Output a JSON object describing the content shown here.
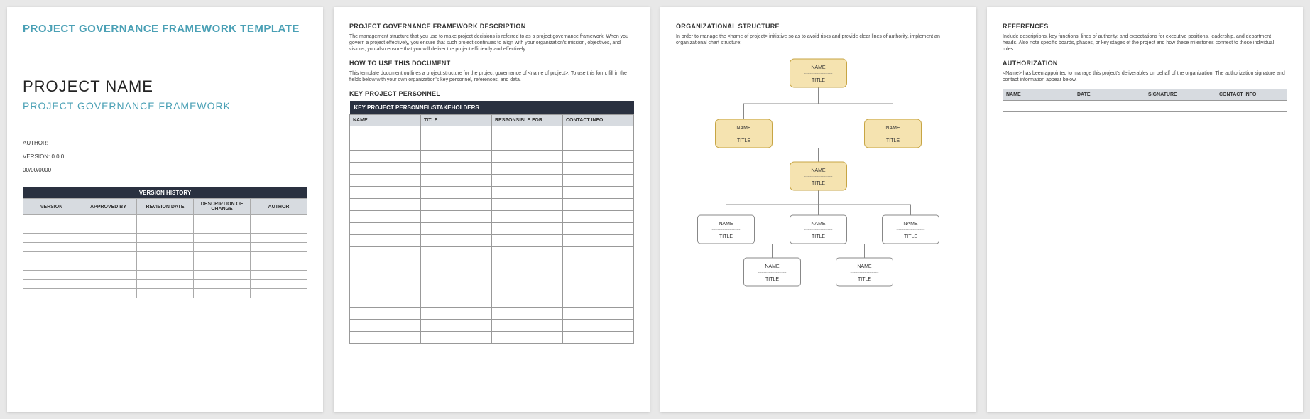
{
  "page1": {
    "title": "PROJECT GOVERNANCE FRAMEWORK TEMPLATE",
    "project_name": "PROJECT NAME",
    "subtitle": "PROJECT GOVERNANCE FRAMEWORK",
    "author_label": "AUTHOR:",
    "version_label": "VERSION: 0.0.0",
    "date_label": "00/00/0000",
    "version_history": {
      "title": "VERSION HISTORY",
      "headers": [
        "VERSION",
        "APPROVED BY",
        "REVISION DATE",
        "DESCRIPTION OF CHANGE",
        "AUTHOR"
      ],
      "row_count": 9
    }
  },
  "page2": {
    "desc_h": "PROJECT GOVERNANCE FRAMEWORK DESCRIPTION",
    "desc_body": "The management structure that you use to make project decisions is referred to as a project governance framework. When you govern a project effectively, you ensure that such project continues to align with your organization's mission, objectives, and visions; you also ensure that you will deliver the project efficiently and effectively.",
    "how_h": "HOW TO USE THIS DOCUMENT",
    "how_body": "This template document outlines a project structure for the project governance of <name of project>. To use this form, fill in the fields below with your own organization's key personnel, references, and data.",
    "kp_h": "KEY PROJECT PERSONNEL",
    "kp_title": "KEY PROJECT PERSONNEL/STAKEHOLDERS",
    "kp_headers": [
      "NAME",
      "TITLE",
      "RESPONSIBLE FOR",
      "CONTACT INFO"
    ],
    "kp_row_count": 18
  },
  "page3": {
    "org_h": "ORGANIZATIONAL STRUCTURE",
    "org_body": "In order to manage the <name of project> initiative so as to avoid risks and provide clear lines of authority, implement an organizational chart structure:",
    "box_name": "NAME",
    "box_title": "TITLE"
  },
  "page4": {
    "ref_h": "REFERENCES",
    "ref_body": "Include descriptions, key functions, lines of authority, and expectations for executive positions, leadership, and department heads. Also note specific boards, phases, or key stages of the project and how these milestones connect to those individual roles.",
    "auth_h": "AUTHORIZATION",
    "auth_body": "<Name> has been appointed to manage this project's deliverables on behalf of the organization. The authorization signature and contact information appear below.",
    "auth_headers": [
      "NAME",
      "DATE",
      "SIGNATURE",
      "CONTACT INFO"
    ]
  }
}
